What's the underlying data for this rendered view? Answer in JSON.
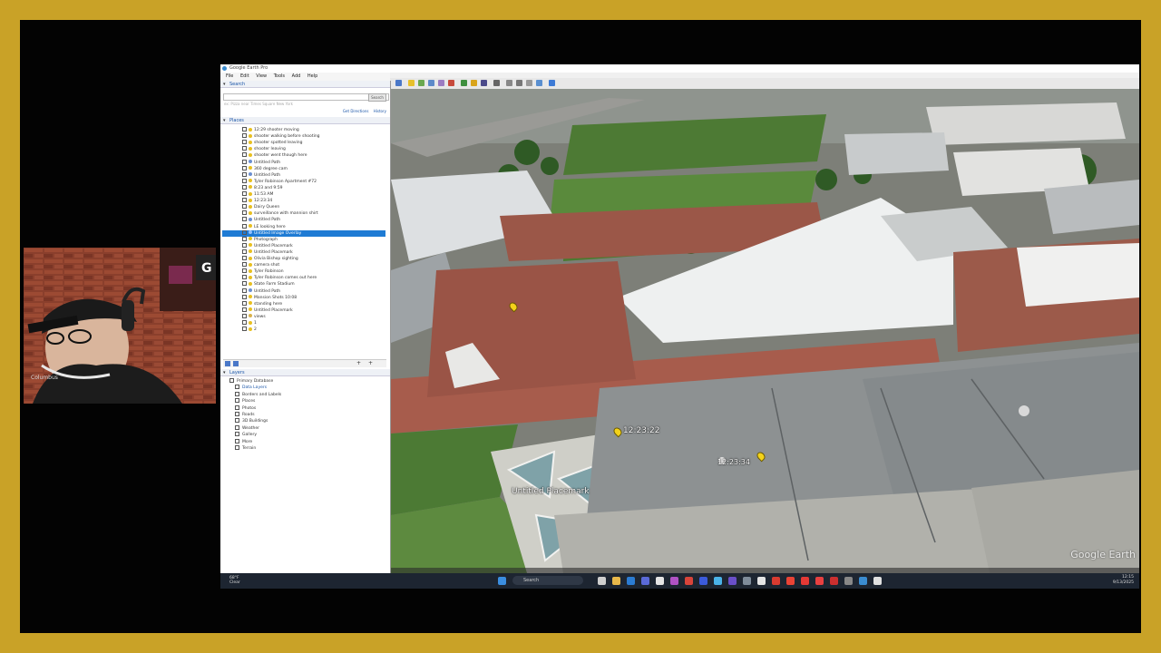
{
  "app": {
    "window_title": "Google Earth Pro",
    "menu": [
      "File",
      "Edit",
      "View",
      "Tools",
      "Add",
      "Help"
    ]
  },
  "search": {
    "header": "Search",
    "button": "Search",
    "history_hint": "ex: Pizza near Times Square New York",
    "links": [
      "Get Directions",
      "History"
    ]
  },
  "places": {
    "header": "Places",
    "items": [
      {
        "label": "12:29 shooter moving",
        "type": "pin"
      },
      {
        "label": "shooter walking before shooting",
        "type": "pin"
      },
      {
        "label": "shooter spotted leaving",
        "type": "pin"
      },
      {
        "label": "shooter leaving",
        "type": "pin"
      },
      {
        "label": "shooter went though here",
        "type": "pin"
      },
      {
        "label": "Untitled Path",
        "type": "path"
      },
      {
        "label": "360 degree cam",
        "type": "pin"
      },
      {
        "label": "Untitled Path",
        "type": "path"
      },
      {
        "label": "Tyler Robinson Apartment #72",
        "type": "pin"
      },
      {
        "label": "8:23 and 9:59",
        "type": "pin"
      },
      {
        "label": "11:53 AM",
        "type": "pin"
      },
      {
        "label": "12:23:34",
        "type": "pin"
      },
      {
        "label": "Dairy Queen",
        "type": "pin"
      },
      {
        "label": "surveillance with mannion shirt",
        "type": "pin"
      },
      {
        "label": "Untitled Path",
        "type": "path"
      },
      {
        "label": "LE looking here",
        "type": "pin"
      },
      {
        "label": "Untitled Image Overlay",
        "type": "overlay",
        "selected": true
      },
      {
        "label": "Photograph",
        "type": "pin"
      },
      {
        "label": "Untitled Placemark",
        "type": "pin"
      },
      {
        "label": "Untitled Placemark",
        "type": "pin"
      },
      {
        "label": "Olivia Bishop sighting",
        "type": "pin"
      },
      {
        "label": "camera shot",
        "type": "pin"
      },
      {
        "label": "Tyler Robinson",
        "type": "pin"
      },
      {
        "label": "Tyler Robinson comes out here",
        "type": "pin"
      },
      {
        "label": "State Farm Stadium",
        "type": "pin"
      },
      {
        "label": "Untitled Path",
        "type": "path"
      },
      {
        "label": "Mansion Shots 10:08",
        "type": "pin"
      },
      {
        "label": "standing here",
        "type": "pin"
      },
      {
        "label": "Untitled Placemark",
        "type": "pin"
      },
      {
        "label": "views",
        "type": "folder"
      },
      {
        "label": "1",
        "type": "pin"
      },
      {
        "label": "2",
        "type": "pin"
      }
    ]
  },
  "layers": {
    "header": "Layers",
    "items": [
      "Primary Database",
      "Data Layers",
      "Borders and Labels",
      "Places",
      "Photos",
      "Roads",
      "3D Buildings",
      "Weather",
      "Gallery",
      "More",
      "Terrain"
    ]
  },
  "map": {
    "placemarks": [
      {
        "label": "12:23:22"
      },
      {
        "label": "12:23:34"
      },
      {
        "label": "Untitled Placemark"
      }
    ],
    "watermark": "Google Earth"
  },
  "taskbar": {
    "weather_temp": "68°F",
    "weather_desc": "Clear",
    "search_label": "Search",
    "tray_time": "12:15",
    "tray_date": "9/13/2025"
  },
  "colors": {
    "frame": "#c9a227",
    "selection": "#1f7bd4",
    "pin": "#f3d21a"
  }
}
